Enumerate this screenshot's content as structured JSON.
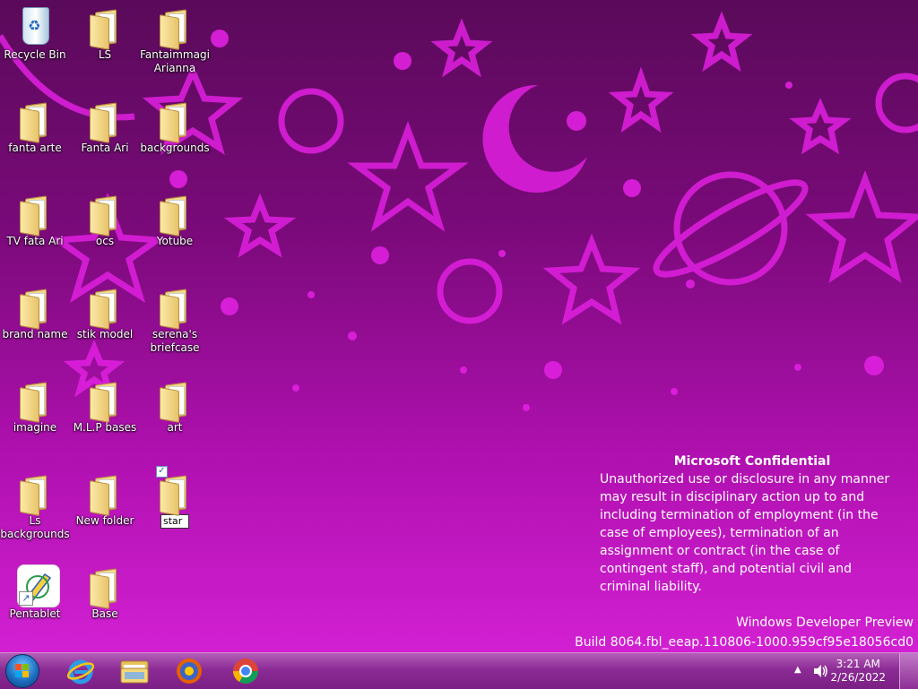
{
  "desktop": {
    "icons": [
      {
        "label": "Recycle Bin",
        "kind": "recycle-bin"
      },
      {
        "label": "LS",
        "kind": "folder"
      },
      {
        "label": "Fantaimmagi Arianna",
        "kind": "folder"
      },
      {
        "label": "fanta arte",
        "kind": "folder"
      },
      {
        "label": "Fanta Ari",
        "kind": "folder"
      },
      {
        "label": "backgrounds",
        "kind": "folder"
      },
      {
        "label": "TV  fata Ari",
        "kind": "folder"
      },
      {
        "label": "ocs",
        "kind": "folder"
      },
      {
        "label": "Yotube",
        "kind": "folder"
      },
      {
        "label": "brand name",
        "kind": "folder"
      },
      {
        "label": "stik  model",
        "kind": "folder"
      },
      {
        "label": "serena's briefcase",
        "kind": "folder"
      },
      {
        "label": "imagine",
        "kind": "folder"
      },
      {
        "label": "M.L.P bases",
        "kind": "folder"
      },
      {
        "label": "art",
        "kind": "folder"
      },
      {
        "label": "Ls backgrounds",
        "kind": "folder"
      },
      {
        "label": "New folder",
        "kind": "folder"
      },
      {
        "label": "star",
        "kind": "folder-renaming"
      },
      {
        "label": "Pentablet",
        "kind": "shortcut"
      },
      {
        "label": "Base",
        "kind": "folder"
      }
    ]
  },
  "watermark": {
    "title": "Microsoft Confidential",
    "body": "Unauthorized use or disclosure in any manner may result in disciplinary action up to and including termination of employment (in the case of employees), termination of an assignment or contract (in the case of contingent staff), and potential civil and criminal liability.",
    "product": "Windows Developer Preview",
    "build": "Build 8064.fbl_eeap.110806-1000.959cf95e18056cd0"
  },
  "taskbar": {
    "pinned": [
      {
        "name": "internet-explorer",
        "icon": "ie-icon"
      },
      {
        "name": "file-explorer",
        "icon": "folder-icon"
      },
      {
        "name": "firefox",
        "icon": "firefox-icon"
      },
      {
        "name": "chrome",
        "icon": "chrome-icon"
      }
    ],
    "tray": {
      "time": "3:21 AM",
      "date": "2/26/2022"
    }
  },
  "colors": {
    "accent": "#b010b0",
    "taskbar": "#8c2b95"
  }
}
